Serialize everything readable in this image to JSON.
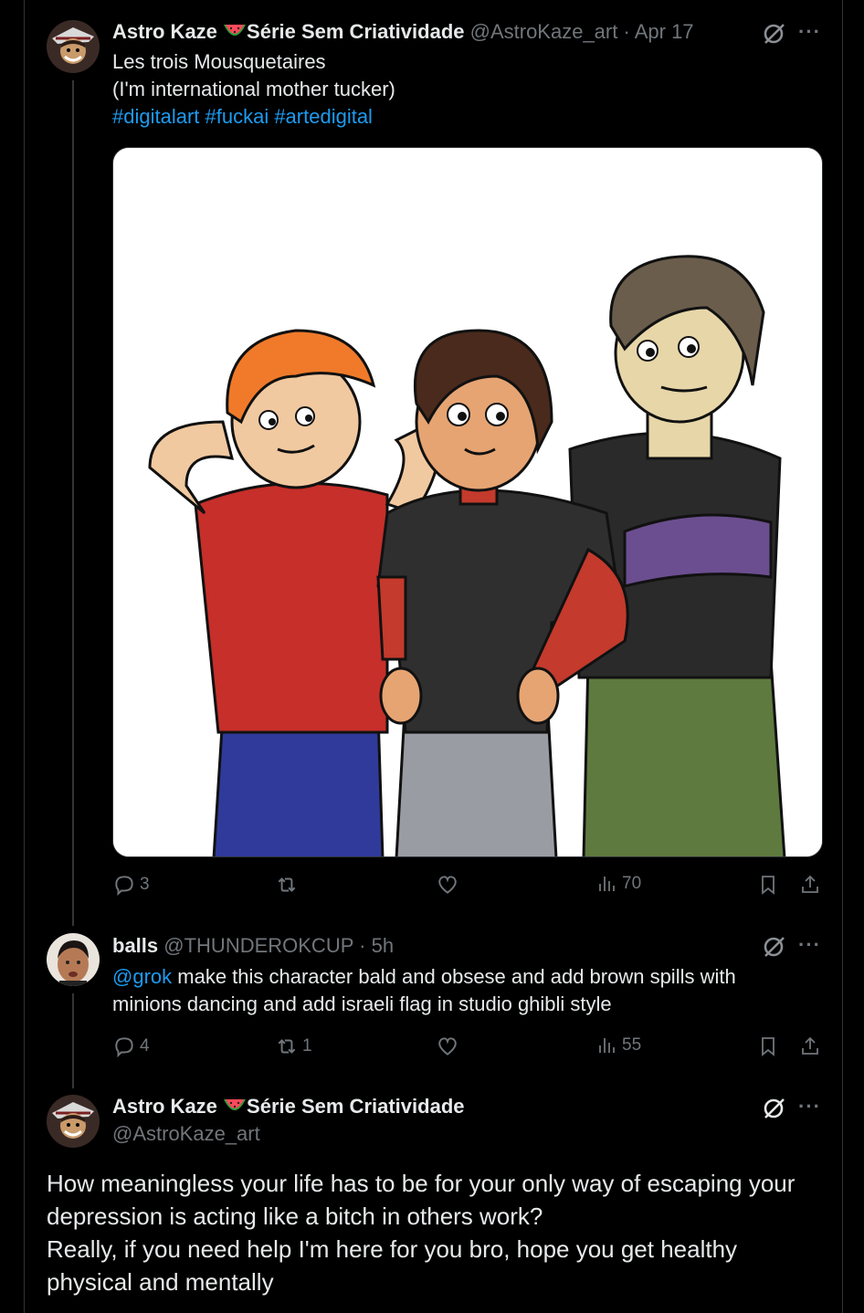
{
  "tweet1": {
    "display_name": "Astro Kaze",
    "display_suffix": "Série Sem Criatividade",
    "handle": "@AstroKaze_art",
    "dot": "·",
    "date": "Apr 17",
    "lines": [
      "Les trois Mousquetaires",
      "(I'm international mother tucker)"
    ],
    "hashtags": "#digitalart #fuckai #artedigital",
    "stats": {
      "replies": "3",
      "reposts": "",
      "likes": "",
      "views": "70"
    }
  },
  "tweet2": {
    "display_name": "balls",
    "handle": "@THUNDEROKCUP",
    "dot": "·",
    "time": "5h",
    "mention": "@grok",
    "text": " make this character bald and obsese and add brown spills with minions dancing and add israeli flag in studio ghibli style",
    "stats": {
      "replies": "4",
      "reposts": "1",
      "likes": "",
      "views": "55"
    }
  },
  "tweet3": {
    "display_name": "Astro Kaze",
    "display_suffix": "Série Sem Criatividade",
    "handle": "@AstroKaze_art",
    "lines": [
      "How meaningless your life has to be for your only way of escaping your",
      "depression is acting like a bitch in others work?",
      "Really, if you need help I'm here for you bro, hope you get healthy",
      "physical and mentally"
    ]
  },
  "icons": {
    "emoji": "watermelon-emoji",
    "more": "more-icon",
    "grok": "grok-icon",
    "reply": "reply-icon",
    "repost": "repost-icon",
    "like": "like-icon",
    "views": "views-icon",
    "bookmark": "bookmark-icon",
    "share": "share-icon"
  },
  "more_label": "···",
  "colors": {
    "background": "#000000",
    "text": "#e7e9ea",
    "muted": "#71767b",
    "link": "#1d9bf0",
    "divider": "#2f3336"
  }
}
